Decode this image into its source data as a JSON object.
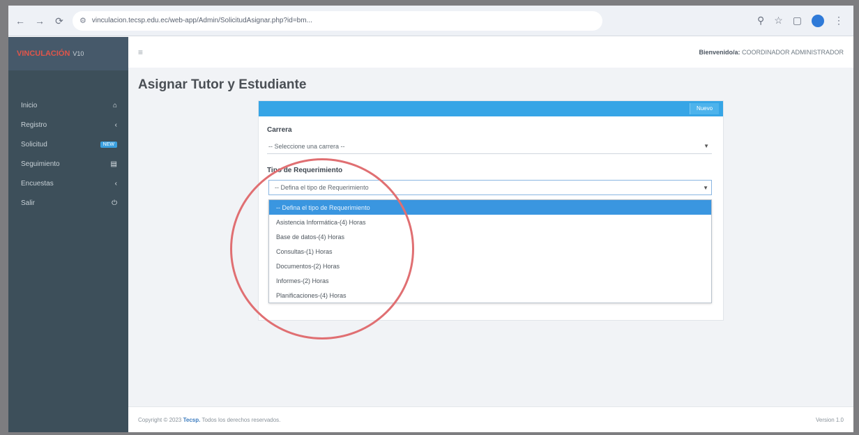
{
  "browser": {
    "url": "vinculacion.tecsp.edu.ec/web-app/Admin/SolicitudAsignar.php?id=bm...",
    "back_icon": "arrow-left-icon",
    "forward_icon": "arrow-right-icon",
    "reload_icon": "reload-icon"
  },
  "sidebar": {
    "brand": "VINCULACIÓN",
    "brand_sub": "V10",
    "items": [
      {
        "label": "Inicio",
        "icon": "home-icon"
      },
      {
        "label": "Registro",
        "icon": "chevron-icon"
      },
      {
        "label": "Solicitud",
        "icon": "badge",
        "badge": "NEW"
      },
      {
        "label": "Seguimiento",
        "icon": "doc-icon"
      },
      {
        "label": "Encuestas",
        "icon": "chevron-icon"
      },
      {
        "label": "Salir",
        "icon": "power-icon"
      }
    ]
  },
  "header": {
    "welcome_label": "Bienvenido/a:",
    "welcome_user": "COORDINADOR ADMINISTRADOR"
  },
  "page": {
    "title": "Asignar Tutor y Estudiante",
    "panel_button": "Nuevo"
  },
  "form": {
    "carrera_label": "Carrera",
    "carrera_value": "-- Seleccione una carrera --",
    "req_label": "Tipo de Requerimiento",
    "req_value": "-- Defina el tipo de Requerimiento",
    "options": [
      "-- Defina el tipo de Requerimiento",
      "Asistencia Informática-(4) Horas",
      "Base de datos-(4) Horas",
      "Consultas-(1) Horas",
      "Documentos-(2) Horas",
      "Informes-(2) Horas",
      "Planificaciones-(4) Horas"
    ]
  },
  "footer": {
    "copyright_pre": "Copyright © 2023",
    "brand": "Tecsp.",
    "rights": "Todos los derechos reservados.",
    "version": "Version 1.0"
  }
}
